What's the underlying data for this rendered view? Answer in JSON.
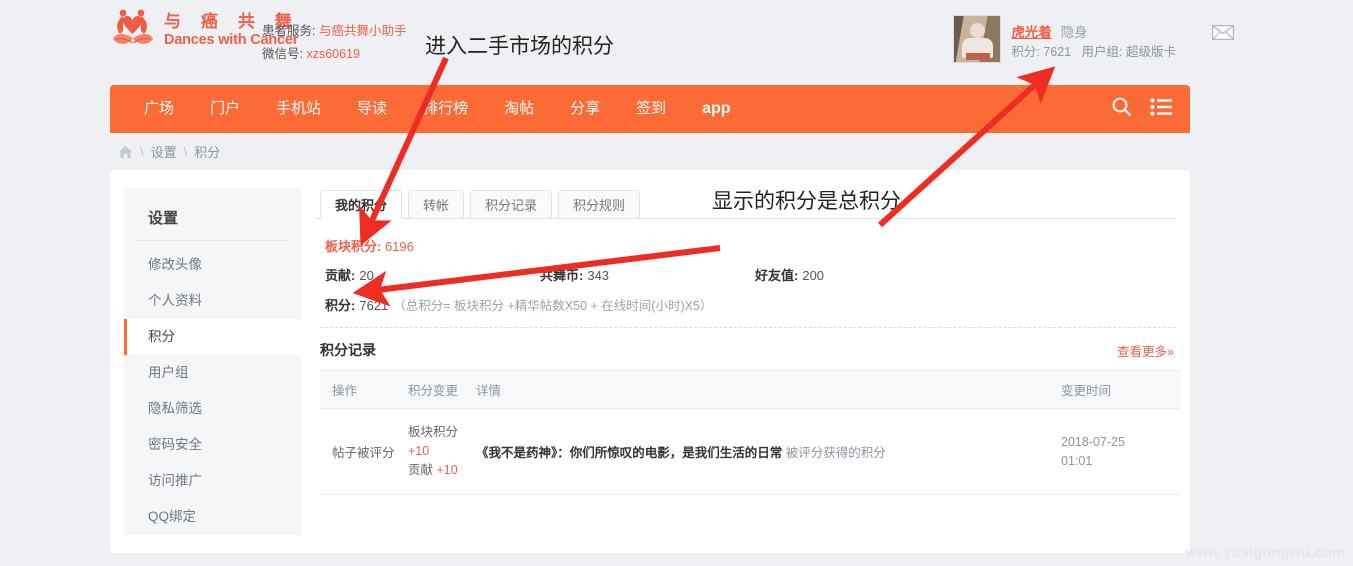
{
  "site": {
    "logo_cn": "与 癌 共 舞",
    "logo_en": "Dances with Cancer",
    "service_label": "患者服务:",
    "service_link": "与癌共舞小助手",
    "wechat_label": "微信号:",
    "wechat_value": "xzs60619"
  },
  "user": {
    "name": "虎光着",
    "status": "隐身",
    "points_label": "积分:",
    "points_value": "7621",
    "group_label": "用户组:",
    "group_value": "超级版卡",
    "message_icon": "envelope-icon"
  },
  "nav": {
    "items": [
      {
        "label": "广场"
      },
      {
        "label": "门户"
      },
      {
        "label": "手机站"
      },
      {
        "label": "导读"
      },
      {
        "label": "排行榜"
      },
      {
        "label": "淘帖"
      },
      {
        "label": "分享"
      },
      {
        "label": "签到"
      },
      {
        "label": "app"
      }
    ],
    "search_icon": "search-icon",
    "menu_icon": "list-menu-icon"
  },
  "breadcrumb": {
    "home_icon": "home-icon",
    "sep": "\\",
    "items": [
      "设置",
      "积分"
    ]
  },
  "sidebar": {
    "title": "设置",
    "items": [
      {
        "label": "修改头像",
        "active": false
      },
      {
        "label": "个人资料",
        "active": false
      },
      {
        "label": "积分",
        "active": true
      },
      {
        "label": "用户组",
        "active": false
      },
      {
        "label": "隐私筛选",
        "active": false
      },
      {
        "label": "密码安全",
        "active": false
      },
      {
        "label": "访问推广",
        "active": false
      },
      {
        "label": "QQ绑定",
        "active": false
      }
    ]
  },
  "tabs": [
    {
      "label": "我的积分",
      "active": true
    },
    {
      "label": "转帐",
      "active": false
    },
    {
      "label": "积分记录",
      "active": false
    },
    {
      "label": "积分规则",
      "active": false
    }
  ],
  "stats": {
    "board_label": "板块积分:",
    "board_value": "6196",
    "contribution_label": "贡献:",
    "contribution_value": "20",
    "coin_label": "共舞币:",
    "coin_value": "343",
    "friend_label": "好友值:",
    "friend_value": "200",
    "total_label": "积分:",
    "total_value": "7621",
    "formula": "（总积分= 板块积分 +精华帖数X50 + 在线时间(小时)X5）"
  },
  "records": {
    "title": "积分记录",
    "more_label": "查看更多»",
    "headers": [
      "操作",
      "积分变更",
      "详情",
      "变更时间"
    ],
    "rows": [
      {
        "operation": "帖子被评分",
        "change_lines": [
          {
            "name": "板块积分",
            "delta": ""
          },
          {
            "name": "",
            "delta": "+10"
          },
          {
            "name": "贡献",
            "delta": "+10"
          }
        ],
        "detail_title": "《我不是药神》：你们所惊叹的电影，是我们生活的日常",
        "detail_rest": "被评分获得的积分",
        "time_date": "2018-07-25",
        "time_clock": "01:01"
      }
    ]
  },
  "annotations": [
    {
      "id": "anno1",
      "text": "进入二手市场的积分"
    },
    {
      "id": "anno2",
      "text": "显示的积分是总积分"
    }
  ],
  "watermark": "www.yuaigongwu.com",
  "colors": {
    "brand_orange": "#fc6a36",
    "link_orange": "#f0604a",
    "page_bg": "#eef0f3",
    "annotation_red": "#ef2c21"
  }
}
